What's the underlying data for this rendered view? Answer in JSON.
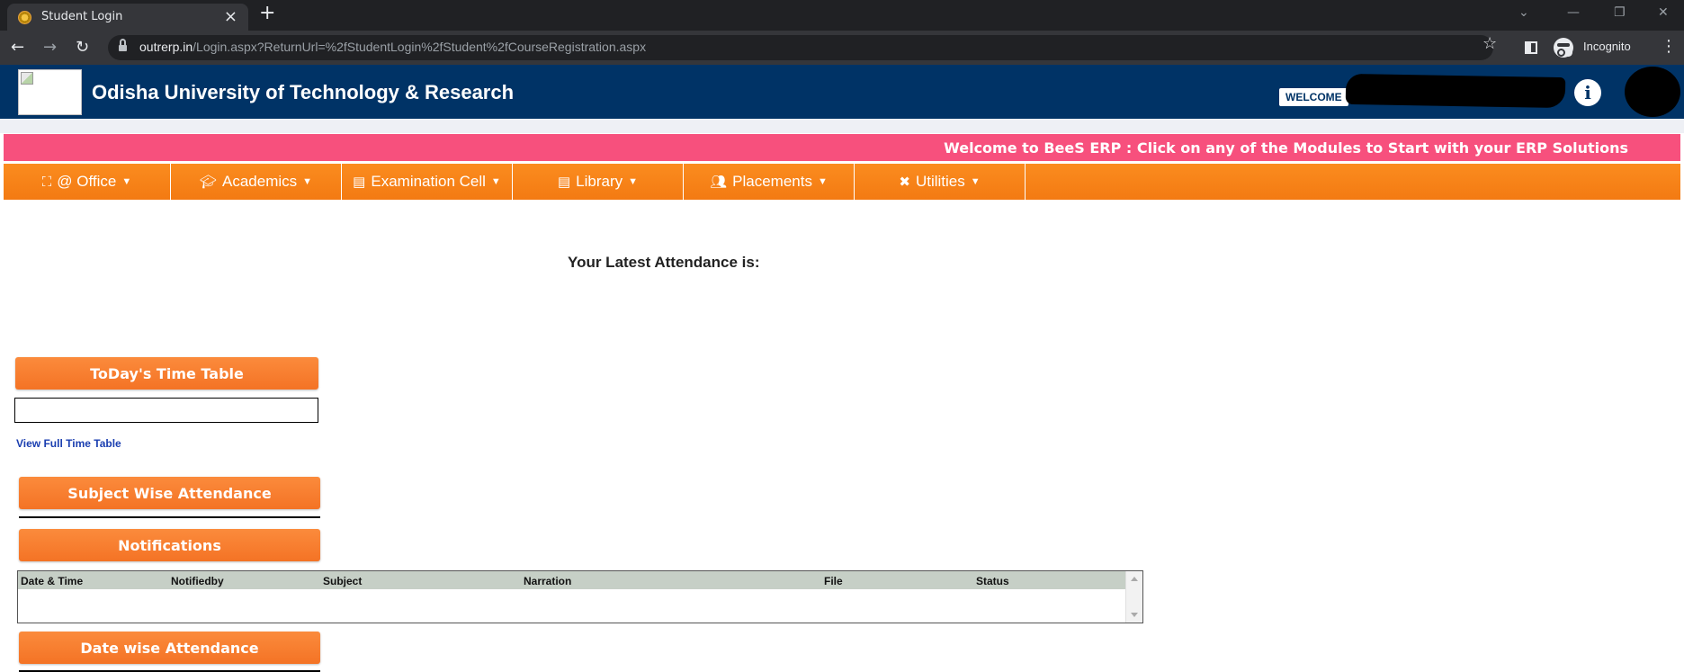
{
  "browser": {
    "tab_title": "Student Login",
    "tab_close": "×",
    "new_tab": "+",
    "url_host": "outrerp.in",
    "url_path": "/Login.aspx?ReturnUrl=%2fStudentLogin%2fStudent%2fCourseRegistration.aspx",
    "incognito_label": "Incognito"
  },
  "header": {
    "title": "Odisha University of Technology & Research",
    "welcome": "WELCOME",
    "info_glyph": "i"
  },
  "marquee": {
    "text": "Welcome to BeeS ERP : Click on any of the Modules to Start with your ERP Solutions"
  },
  "nav": {
    "items": [
      {
        "label": "@ Office",
        "icon": "sitemap-icon"
      },
      {
        "label": "Academics",
        "icon": "graduation-cap-icon"
      },
      {
        "label": "Examination Cell",
        "icon": "clipboard-icon"
      },
      {
        "label": "Library",
        "icon": "clipboard-icon"
      },
      {
        "label": "Placements",
        "icon": "users-icon"
      },
      {
        "label": "Utilities",
        "icon": "tools-icon"
      }
    ]
  },
  "main": {
    "attendance_heading": "Your Latest Attendance is:",
    "timetable_title": "ToDay's Time Table",
    "view_full_timetable": "View Full Time Table",
    "subject_attendance_title": "Subject Wise Attendance",
    "notifications_title": "Notifications",
    "notification_columns": [
      "Date & Time",
      "Notifiedby",
      "Subject",
      "Narration",
      "File",
      "Status"
    ],
    "date_attendance_title": "Date wise Attendance"
  },
  "colors": {
    "header_bg": "#003366",
    "marquee_bg": "#f7507d",
    "nav_bg": "#f37a12",
    "panel_bg": "#f47325"
  }
}
